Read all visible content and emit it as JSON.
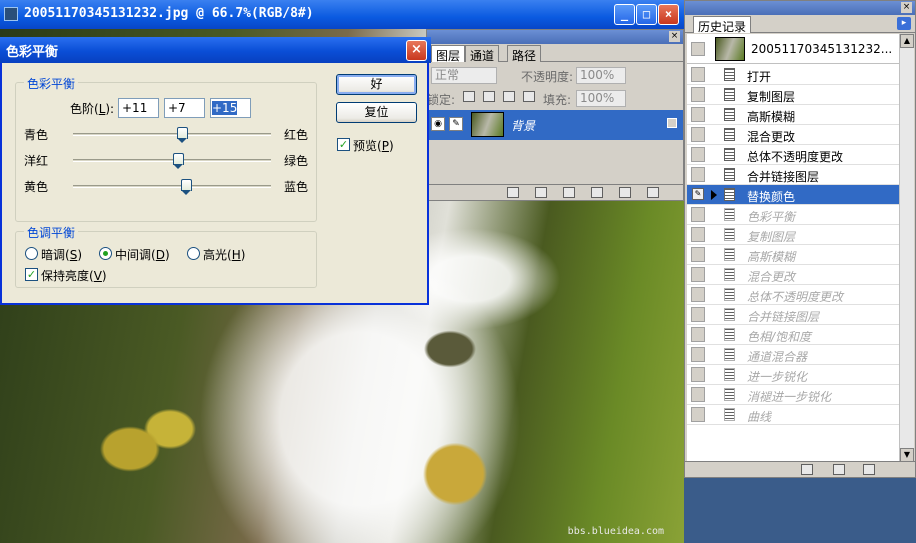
{
  "image_window": {
    "title": "20051170345131232.jpg @ 66.7%(RGB/8#)",
    "watermark": "bbs.blueidea.com"
  },
  "layers_panel": {
    "tabs": [
      "图层",
      "通道",
      "路径"
    ],
    "blend_mode": "正常",
    "opacity_label": "不透明度:",
    "opacity_value": "100%",
    "lock_label": "锁定:",
    "fill_label": "填充:",
    "fill_value": "100%",
    "layer_name": "背景"
  },
  "history_panel": {
    "tab": "历史记录",
    "snapshot_name": "20051170345131232...",
    "current_index": 6,
    "items": [
      "打开",
      "复制图层",
      "高斯模糊",
      "混合更改",
      "总体不透明度更改",
      "合并链接图层",
      "替换颜色",
      "色彩平衡",
      "复制图层",
      "高斯模糊",
      "混合更改",
      "总体不透明度更改",
      "合并链接图层",
      "色相/饱和度",
      "通道混合器",
      "进一步锐化",
      "消褪进一步锐化",
      "曲线"
    ]
  },
  "dialog": {
    "title": "色彩平衡",
    "color_balance_group": "色彩平衡",
    "levels_label": "色阶(",
    "levels_key": "L",
    "levels_suffix": "):",
    "levels": [
      "+11",
      "+7",
      "+15"
    ],
    "sliders": [
      {
        "left": "青色",
        "right": "红色",
        "value": 11
      },
      {
        "left": "洋红",
        "right": "绿色",
        "value": 7
      },
      {
        "left": "黄色",
        "right": "蓝色",
        "value": 15
      }
    ],
    "tone_group": "色调平衡",
    "tones": [
      {
        "label": "暗调",
        "key": "S",
        "selected": false
      },
      {
        "label": "中间调",
        "key": "D",
        "selected": true
      },
      {
        "label": "高光",
        "key": "H",
        "selected": false
      }
    ],
    "preserve_label": "保持亮度",
    "preserve_key": "V",
    "preserve_checked": true,
    "ok_label": "好",
    "reset_label": "复位",
    "preview_label": "预览",
    "preview_key": "P",
    "preview_checked": true
  },
  "colors": {
    "selection": "#316ac5",
    "title_blue": "#0a4ed6",
    "group_label": "#0046d5"
  }
}
